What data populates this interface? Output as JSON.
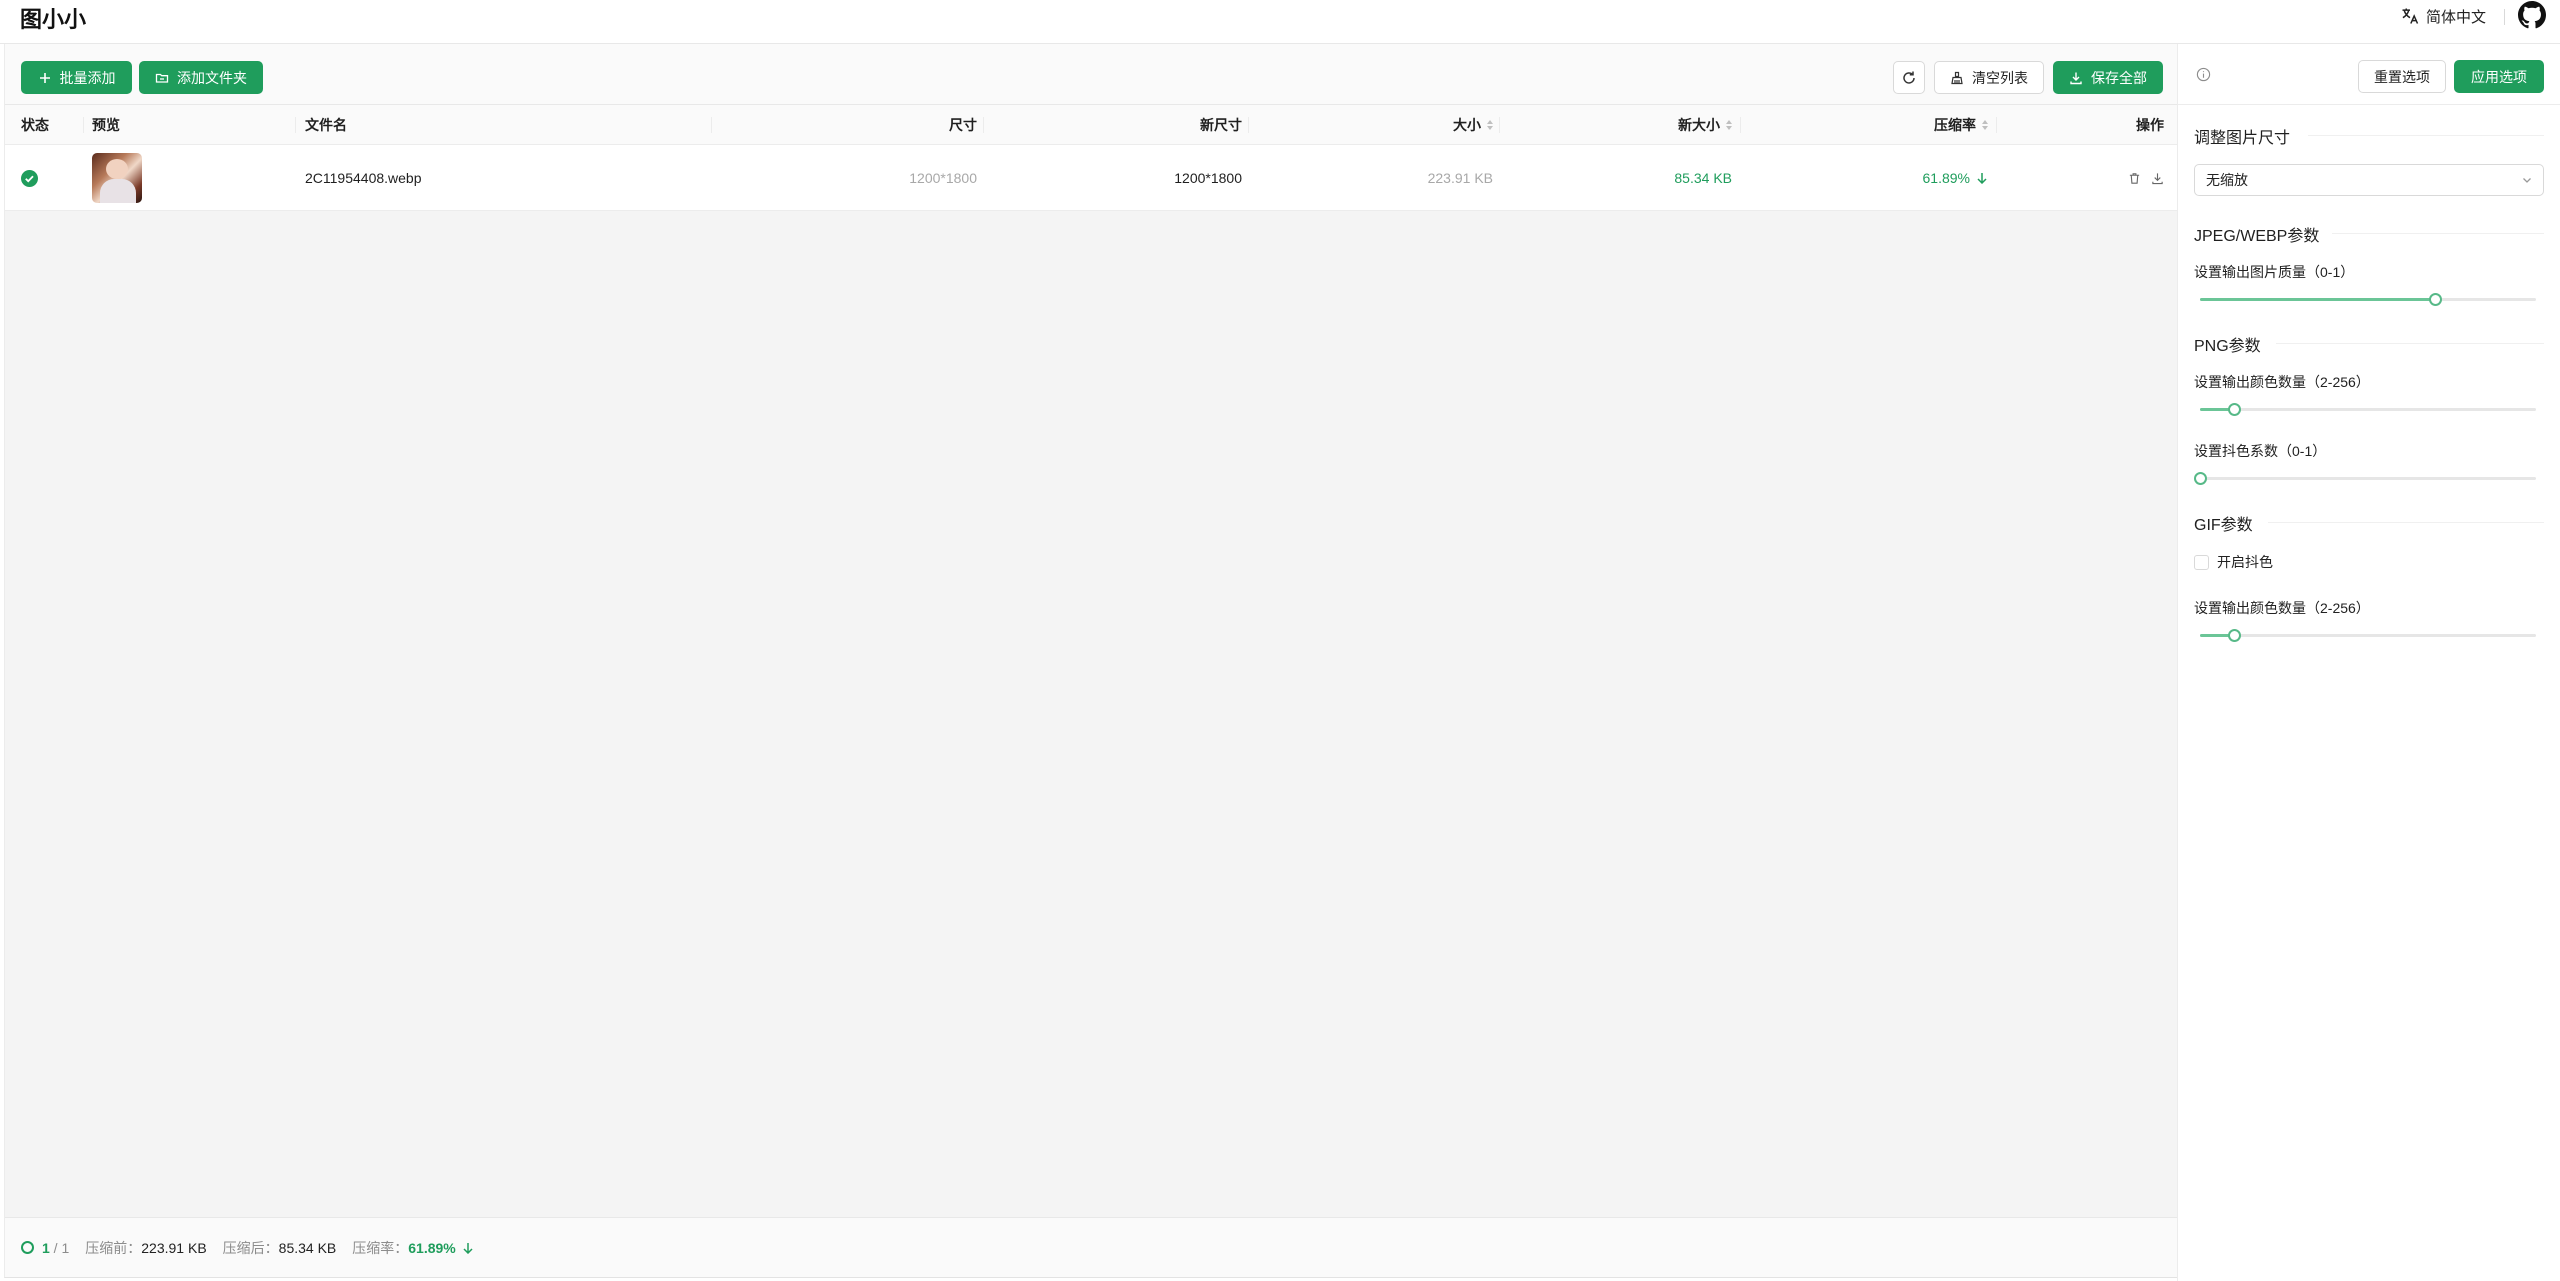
{
  "app": {
    "title": "图小小",
    "language": "简体中文"
  },
  "toolbar": {
    "batch_add": "批量添加",
    "add_folder": "添加文件夹",
    "clear_list": "清空列表",
    "save_all": "保存全部"
  },
  "table": {
    "columns": {
      "status": "状态",
      "preview": "预览",
      "filename": "文件名",
      "size": "尺寸",
      "new_size": "新尺寸",
      "filesize": "大小",
      "new_filesize": "新大小",
      "ratio": "压缩率",
      "actions": "操作"
    },
    "rows": [
      {
        "status": "done",
        "filename": "2C11954408.webp",
        "dimensions": "1200*1800",
        "new_dimensions": "1200*1800",
        "size": "223.91 KB",
        "new_size": "85.34 KB",
        "ratio": "61.89%"
      }
    ]
  },
  "footer": {
    "done": "1",
    "separator": " / ",
    "total": "1",
    "before_label": "压缩前：",
    "before_value": "223.91 KB",
    "after_label": "压缩后：",
    "after_value": "85.34 KB",
    "ratio_label": "压缩率：",
    "ratio_value": "61.89%"
  },
  "panel": {
    "reset": "重置选项",
    "apply": "应用选项",
    "resize_title": "调整图片尺寸",
    "resize_value": "无缩放",
    "jpeg_title": "JPEG/WEBP参数",
    "jpeg_quality_label": "设置输出图片质量（0-1）",
    "jpeg_quality_value": 0.7,
    "png_title": "PNG参数",
    "png_colors_label": "设置输出颜色数量（2-256）",
    "png_colors_value": 0.1,
    "png_dither_label": "设置抖色系数（0-1）",
    "png_dither_value": 0,
    "gif_title": "GIF参数",
    "gif_dither_label": "开启抖色",
    "gif_dither_checked": false,
    "gif_colors_label": "设置输出颜色数量（2-256）",
    "gif_colors_value": 0.1
  },
  "colors": {
    "primary": "#1f9d5c",
    "slider_track": "#6bc597"
  }
}
